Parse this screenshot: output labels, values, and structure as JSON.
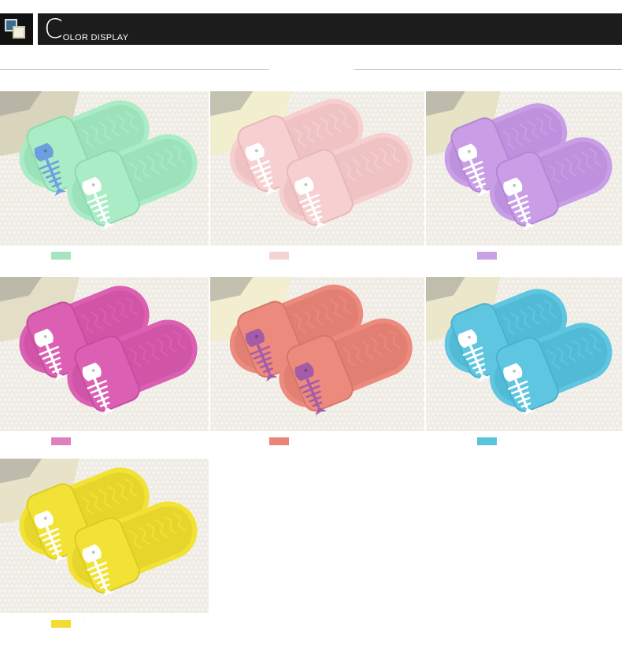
{
  "header": {
    "title_initial": "C",
    "title_rest": "OLOR DISPLAY"
  },
  "colors": {
    "header_bg": "#1c1c1c",
    "page_bg": "#ffffff",
    "fish_white": "#ffffff"
  },
  "variants": [
    {
      "name": "green",
      "slipper": "#a9ecc5",
      "shade": "#8fd9b0",
      "fish": "#6d9fe0",
      "fish2": "#ffffff",
      "swatch": "#a6e4c0",
      "bg_card": "#d9d5bd",
      "mark": ""
    },
    {
      "name": "pink",
      "slipper": "#f6cfd0",
      "shade": "#e9b8ba",
      "fish": "#ffffff",
      "fish2": "#ffffff",
      "swatch": "#f4d4d2",
      "bg_card": "#f2efcf",
      "mark": ""
    },
    {
      "name": "purple",
      "slipper": "#c99ee6",
      "shade": "#b386d6",
      "fish": "#ffffff",
      "fish2": "#ffffff",
      "swatch": "#c8a2e2",
      "bg_card": "#e6e3c7",
      "mark": "."
    },
    {
      "name": "magenta",
      "slipper": "#db5fb2",
      "shade": "#c64c9f",
      "fish": "#ffffff",
      "fish2": "#ffffff",
      "swatch": "#e07fbf",
      "bg_card": "#e3dec5",
      "mark": ""
    },
    {
      "name": "coral",
      "slipper": "#ec8a7d",
      "shade": "#d7766a",
      "fish": "#a45ca8",
      "fish2": "#a45ca8",
      "swatch": "#e98577",
      "bg_card": "#f3eecf",
      "mark": "."
    },
    {
      "name": "blue",
      "slipper": "#5ec6e0",
      "shade": "#48b1cc",
      "fish": "#ffffff",
      "fish2": "#ffffff",
      "swatch": "#5bc3de",
      "bg_card": "#ebe7cb",
      "mark": ""
    },
    {
      "name": "yellow",
      "slipper": "#f2e236",
      "shade": "#dccb22",
      "fish": "#ffffff",
      "fish2": "#ffffff",
      "swatch": "#f1dc33",
      "bg_card": "#e8e2c8",
      "mark": "."
    }
  ]
}
